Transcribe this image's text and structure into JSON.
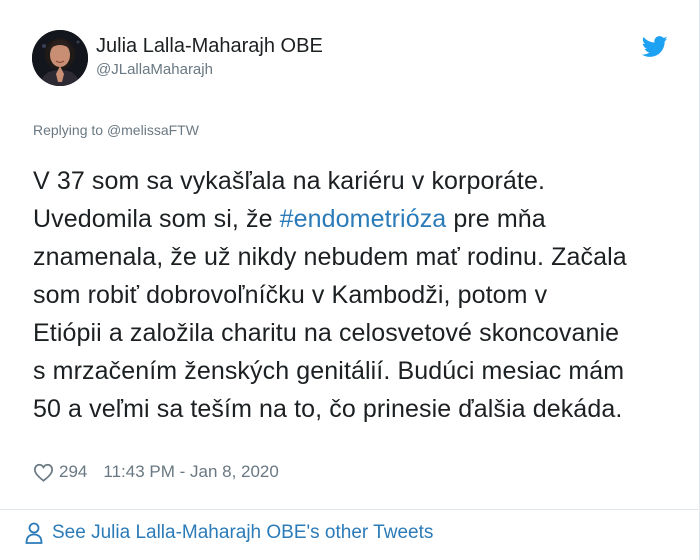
{
  "author": {
    "display_name": "Julia Lalla-Maharajh OBE",
    "handle": "@JLallaMaharajh",
    "avatar_icon": "person-photo"
  },
  "reply": {
    "prefix": "Replying to ",
    "to_handle": "@melissaFTW"
  },
  "tweet": {
    "line1": "V 37 som sa vykašľala na kariéru v korporáte.",
    "line2_before": "Uvedomila som si, že ",
    "hashtag": "#endometrióza",
    "line2_after": " pre mňa",
    "line3": "znamenala, že už nikdy nebudem mať rodinu. Začala",
    "line4": "som robiť dobrovoľníčku v Kambodži, potom v",
    "line5": "Etiópii a založila charitu na celosvetové skoncovanie",
    "line6": "s mrzačením ženských genitálií. Budúci mesiac mám",
    "line7": "50 a veľmi sa teším na to, čo prinesie ďalšia dekáda."
  },
  "meta": {
    "like_count": "294",
    "timestamp": "11:43 PM - Jan 8, 2020",
    "heart_icon": "heart-outline"
  },
  "footer": {
    "link_text": "See Julia Lalla-Maharajh OBE's other Tweets",
    "icon": "person-outline"
  },
  "colors": {
    "link": "#2b7bb9",
    "twitter_blue": "#1da1f2",
    "muted": "#697882",
    "text": "#1c2022",
    "border": "#e1e8ed"
  }
}
